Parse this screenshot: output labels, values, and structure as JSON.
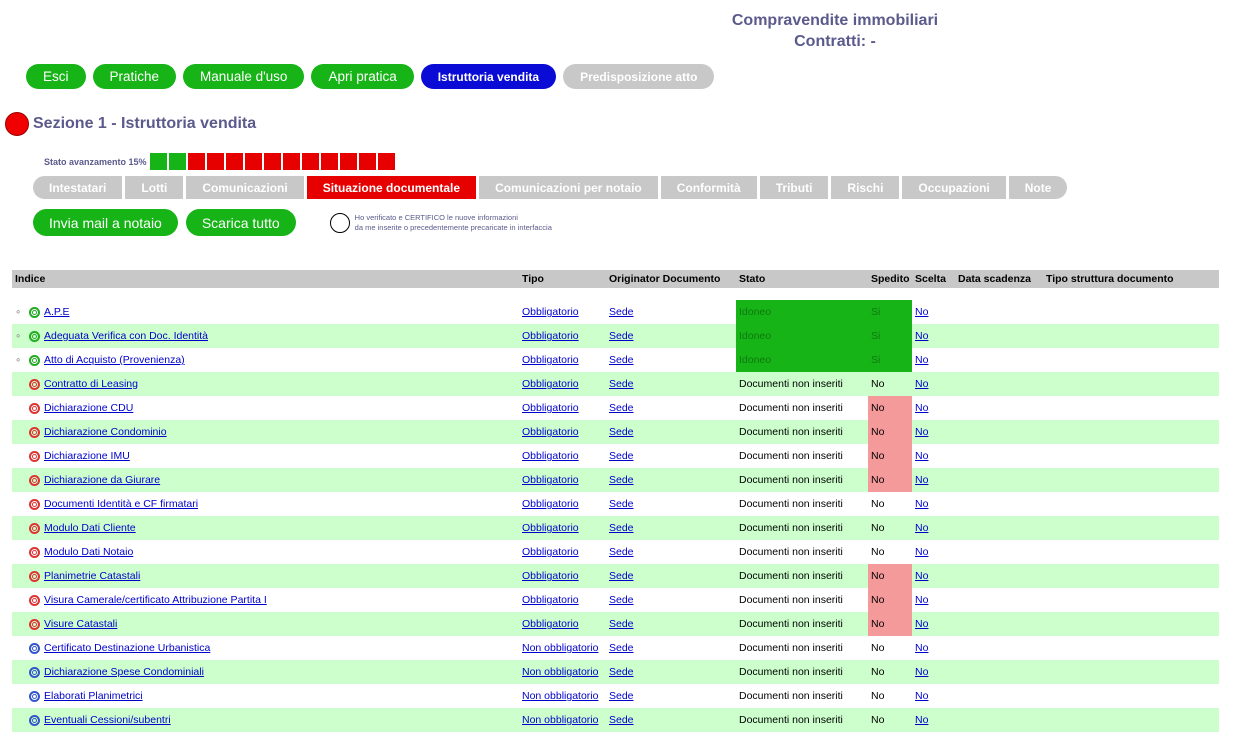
{
  "header": {
    "title_line1": "Compravendite immobiliari",
    "title_line2": "Contratti: -"
  },
  "top_nav": [
    "Esci",
    "Pratiche",
    "Manuale d'uso",
    "Apri pratica",
    "Istruttoria vendita",
    "Predisposizione atto"
  ],
  "section": {
    "title": "Sezione 1 - Istruttoria vendita"
  },
  "progress": {
    "label": "Stato avanzamento 15%",
    "percent": 15,
    "done_blocks": 2,
    "total_blocks": 13
  },
  "subtabs": [
    "Intestatari",
    "Lotti",
    "Comunicazioni",
    "Situazione documentale",
    "Comunicazioni per notaio",
    "Conformità",
    "Tributi",
    "Rischi",
    "Occupazioni",
    "Note"
  ],
  "actions": {
    "mail": "Invia mail a notaio",
    "download": "Scarica tutto",
    "cert_line1": "Ho verificato e CERTIFICO le nuove informazioni",
    "cert_line2": "da me inserite o precedentemente precaricate in interfaccia"
  },
  "table": {
    "headers": [
      "Indice",
      "Tipo",
      "Originator Documento",
      "Stato",
      "Spedito",
      "Scelta",
      "Data scadenza",
      "Tipo struttura documento"
    ],
    "rows": [
      {
        "indice": "A.P.E",
        "tipo": "Obbligatorio",
        "orig": "Sede",
        "stato": "Idoneo",
        "spedito": "Si",
        "scelta": "No",
        "icon": "green",
        "clip": true
      },
      {
        "indice": "Adeguata Verifica con Doc. Identità",
        "tipo": "Obbligatorio",
        "orig": "Sede",
        "stato": "Idoneo",
        "spedito": "Si",
        "scelta": "No",
        "icon": "green",
        "clip": true
      },
      {
        "indice": "Atto di Acquisto (Provenienza)",
        "tipo": "Obbligatorio",
        "orig": "Sede",
        "stato": "Idoneo",
        "spedito": "Si",
        "scelta": "No",
        "icon": "green",
        "clip": true
      },
      {
        "indice": "Contratto di Leasing",
        "tipo": "Obbligatorio",
        "orig": "Sede",
        "stato": "Documenti non inseriti",
        "spedito": "No",
        "scelta": "No",
        "icon": "red",
        "clip": false
      },
      {
        "indice": "Dichiarazione CDU",
        "tipo": "Obbligatorio",
        "orig": "Sede",
        "stato": "Documenti non inseriti",
        "spedito": "No",
        "scelta": "No",
        "icon": "red",
        "clip": false,
        "sped_ko": true
      },
      {
        "indice": "Dichiarazione Condominio",
        "tipo": "Obbligatorio",
        "orig": "Sede",
        "stato": "Documenti non inseriti",
        "spedito": "No",
        "scelta": "No",
        "icon": "red",
        "clip": false,
        "sped_ko": true
      },
      {
        "indice": "Dichiarazione IMU",
        "tipo": "Obbligatorio",
        "orig": "Sede",
        "stato": "Documenti non inseriti",
        "spedito": "No",
        "scelta": "No",
        "icon": "red",
        "clip": false,
        "sped_ko": true
      },
      {
        "indice": "Dichiarazione da Giurare",
        "tipo": "Obbligatorio",
        "orig": "Sede",
        "stato": "Documenti non inseriti",
        "spedito": "No",
        "scelta": "No",
        "icon": "red",
        "clip": false,
        "sped_ko": true
      },
      {
        "indice": "Documenti Identità e CF firmatari",
        "tipo": "Obbligatorio",
        "orig": "Sede",
        "stato": "Documenti non inseriti",
        "spedito": "No",
        "scelta": "No",
        "icon": "red",
        "clip": false
      },
      {
        "indice": "Modulo Dati Cliente",
        "tipo": "Obbligatorio",
        "orig": "Sede",
        "stato": "Documenti non inseriti",
        "spedito": "No",
        "scelta": "No",
        "icon": "red",
        "clip": false
      },
      {
        "indice": "Modulo Dati Notaio",
        "tipo": "Obbligatorio",
        "orig": "Sede",
        "stato": "Documenti non inseriti",
        "spedito": "No",
        "scelta": "No",
        "icon": "red",
        "clip": false
      },
      {
        "indice": "Planimetrie Catastali",
        "tipo": "Obbligatorio",
        "orig": "Sede",
        "stato": "Documenti non inseriti",
        "spedito": "No",
        "scelta": "No",
        "icon": "red",
        "clip": false,
        "sped_ko": true
      },
      {
        "indice": "Visura Camerale/certificato Attribuzione Partita I",
        "tipo": "Obbligatorio",
        "orig": "Sede",
        "stato": "Documenti non inseriti",
        "spedito": "No",
        "scelta": "No",
        "icon": "red",
        "clip": false,
        "sped_ko": true
      },
      {
        "indice": "Visure Catastali",
        "tipo": "Obbligatorio",
        "orig": "Sede",
        "stato": "Documenti non inseriti",
        "spedito": "No",
        "scelta": "No",
        "icon": "red",
        "clip": false,
        "sped_ko": true
      },
      {
        "indice": "Certificato Destinazione Urbanistica",
        "tipo": "Non obbligatorio",
        "orig": "Sede",
        "stato": "Documenti non inseriti",
        "spedito": "No",
        "scelta": "No",
        "icon": "blue",
        "clip": false
      },
      {
        "indice": "Dichiarazione Spese Condominiali",
        "tipo": "Non obbligatorio",
        "orig": "Sede",
        "stato": "Documenti non inseriti",
        "spedito": "No",
        "scelta": "No",
        "icon": "blue",
        "clip": false
      },
      {
        "indice": "Elaborati Planimetrici",
        "tipo": "Non obbligatorio",
        "orig": "Sede",
        "stato": "Documenti non inseriti",
        "spedito": "No",
        "scelta": "No",
        "icon": "blue",
        "clip": false
      },
      {
        "indice": "Eventuali Cessioni/subentri",
        "tipo": "Non obbligatorio",
        "orig": "Sede",
        "stato": "Documenti non inseriti",
        "spedito": "No",
        "scelta": "No",
        "icon": "blue",
        "clip": false
      }
    ]
  }
}
